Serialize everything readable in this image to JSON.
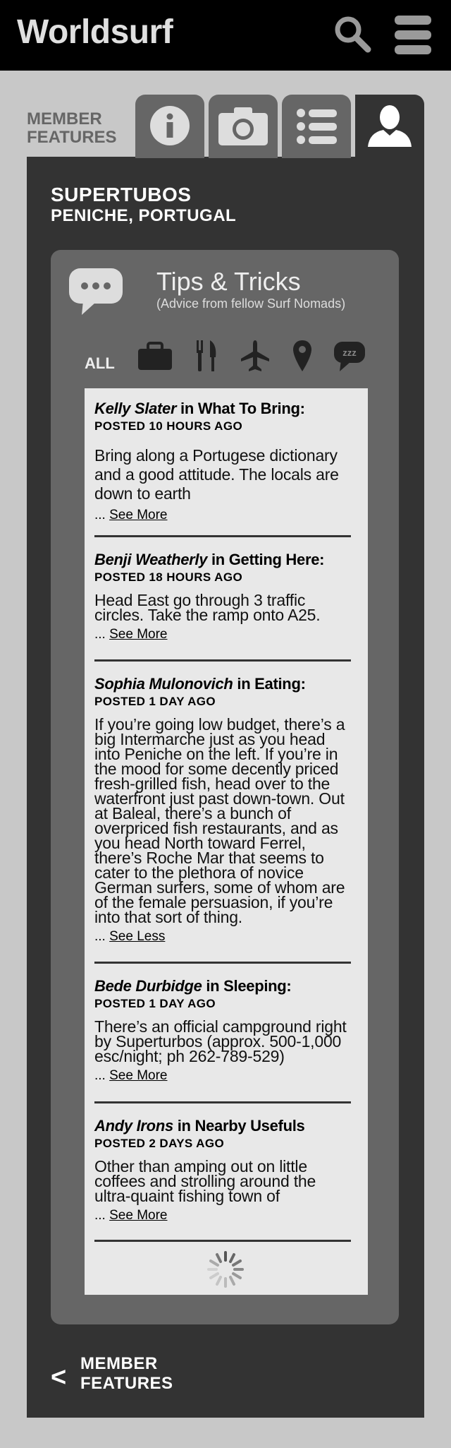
{
  "app": {
    "title": "Worldsurf"
  },
  "nav": {
    "features_label_line1": "MEMBER",
    "features_label_line2": "FEATURES"
  },
  "tabs": [
    {
      "icon": "info-icon"
    },
    {
      "icon": "camera-icon"
    },
    {
      "icon": "list-icon"
    },
    {
      "icon": "member-icon",
      "active": true
    }
  ],
  "location": {
    "name": "SUPERTUBOS",
    "place": "PENICHE, PORTUGAL"
  },
  "tips": {
    "title": "Tips & Tricks",
    "subtitle": "(Advice from fellow Surf Nomads)",
    "filters": {
      "all": "ALL",
      "icons": [
        "briefcase-icon",
        "fork-knife-icon",
        "airplane-icon",
        "map-pin-icon",
        "sleep-bubble-icon"
      ],
      "sleep_text": "zzz"
    },
    "entries": [
      {
        "author": "Kelly Slater",
        "category": " in What To Bring:",
        "posted": "POSTED 10 HOURS AGO",
        "body": "Bring along a Portugese dictionary and a good attitude. The locals are down to earth",
        "more_prefix": "... ",
        "more": "See More"
      },
      {
        "author": "Benji Weatherly",
        "category": " in Getting Here:",
        "posted": "POSTED 18 HOURS AGO",
        "body": "Head East go through 3 traffic circles. Take the ramp onto A25.",
        "more_prefix": "... ",
        "more": "See More"
      },
      {
        "author": "Sophia Mulonovich",
        "category": " in Eating:",
        "posted": "POSTED 1 DAY AGO",
        "body": "If you’re going low budget, there’s a big Intermarche just as you head into Peniche on the left. If you’re in the mood for some decently priced fresh-grilled fish, head over to the waterfront just past down-town. Out at Baleal, there’s a bunch of overpriced fish restaurants, and as you head North toward Ferrel, there’s Roche Mar that seems to cater to the plethora of novice German surfers, some of whom are of the female persuasion, if you’re into that sort of thing.",
        "more_prefix": "... ",
        "more": "See Less"
      },
      {
        "author": "Bede Durbidge",
        "category": " in Sleeping:",
        "posted": "POSTED 1 DAY AGO",
        "body": "There’s an official campground right by Superturbos (approx. 500-1,000 esc/night; ph 262-789-529)",
        "more_prefix": "... ",
        "more": "See More"
      },
      {
        "author": "Andy Irons",
        "category": " in Nearby Usefuls",
        "posted": "POSTED 2 DAYS AGO",
        "body": "Other than amping out on little coffees and strolling around the ultra-quaint fishing town of",
        "more_prefix": "... ",
        "more": "See More"
      }
    ]
  },
  "footer": {
    "back_arrow": "<",
    "back_line1": "MEMBER",
    "back_line2": "FEATURES"
  },
  "colors": {
    "topbar": "#000000",
    "panel": "#333333",
    "card": "#666666",
    "list": "#e8e8e8",
    "page": "#c8c8c8"
  }
}
